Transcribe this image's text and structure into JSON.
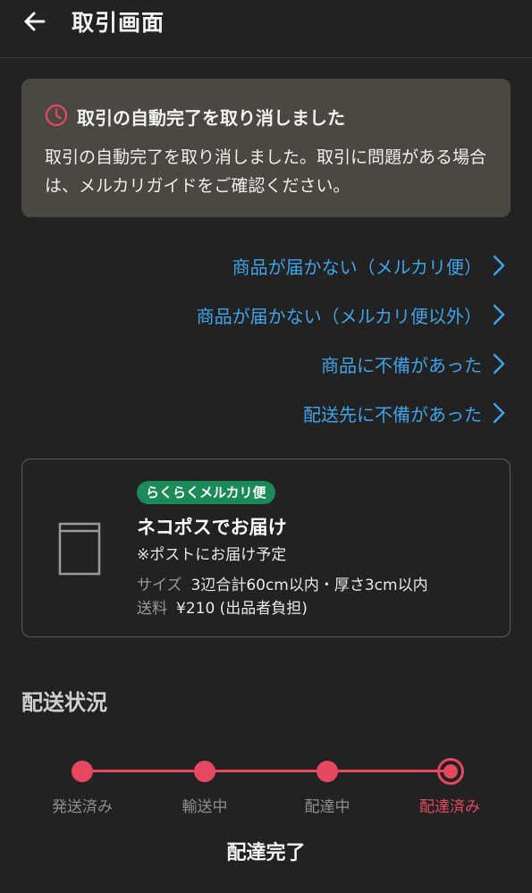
{
  "header": {
    "title": "取引画面"
  },
  "notice": {
    "title": "取引の自動完了を取り消しました",
    "body": "取引の自動完了を取り消しました。取引に問題がある場合は、メルカリガイドをご確認ください。"
  },
  "help_links": [
    {
      "label": "商品が届かない（メルカリ便）"
    },
    {
      "label": "商品が届かない（メルカリ便以外）"
    },
    {
      "label": "商品に不備があった"
    },
    {
      "label": "配送先に不備があった"
    }
  ],
  "shipping": {
    "badge": "らくらくメルカリ便",
    "method": "ネコポスでお届け",
    "note": "※ポストにお届け予定",
    "size_label": "サイズ",
    "size_value": "3辺合計60cm以内・厚さ3cm以内",
    "fee_label": "送料",
    "fee_value": "¥210 (出品者負担)"
  },
  "status": {
    "section_title": "配送状況",
    "steps": [
      "発送済み",
      "輸送中",
      "配達中",
      "配達済み"
    ],
    "current_step_index": 3,
    "result": "配達完了"
  },
  "colors": {
    "background": "#222222",
    "notice_bg": "#4a4843",
    "link": "#3fa3e8",
    "accent_red": "#e5485f",
    "badge_green": "#1a8a58"
  },
  "icons": {
    "back": "arrow-left-icon",
    "notice": "clock-icon",
    "link": "chevron-right-icon",
    "shipping": "envelope-icon"
  }
}
